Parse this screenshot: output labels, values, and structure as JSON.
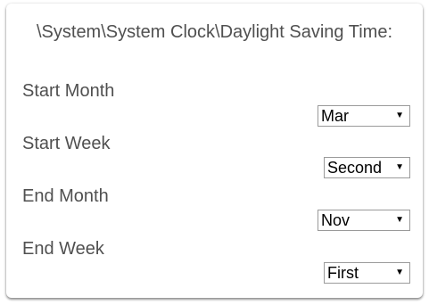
{
  "panel": {
    "title": "\\System\\System Clock\\Daylight Saving Time:"
  },
  "fields": [
    {
      "label": "Start Month",
      "value": "Mar"
    },
    {
      "label": "Start Week",
      "value": "Second"
    },
    {
      "label": "End Month",
      "value": "Nov"
    },
    {
      "label": "End Week",
      "value": "First"
    }
  ],
  "icons": {
    "dropdown": "chevron-down-icon"
  }
}
